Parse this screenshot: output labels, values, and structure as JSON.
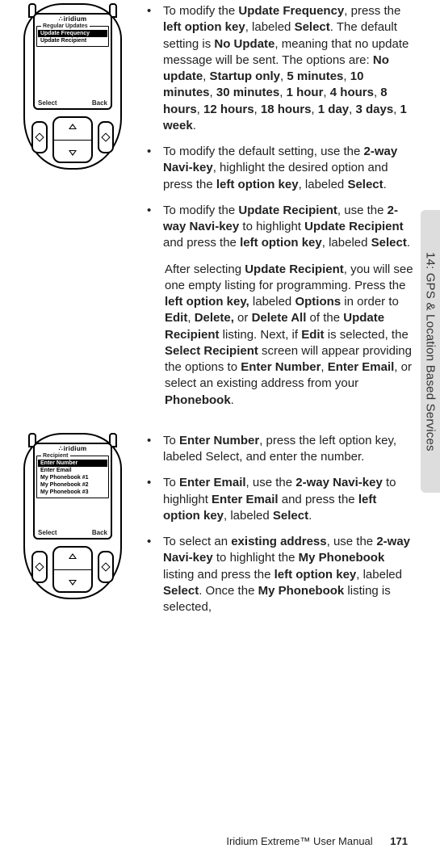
{
  "sideTab": "14: GPS & Location Based Services",
  "footer": {
    "title": "Iridium Extreme™ User Manual",
    "page": "171"
  },
  "device1": {
    "brand": "iridium",
    "menuTitle": "Regular Updates",
    "items": [
      "Update Frequency",
      "Update Recipient"
    ],
    "selectedIndex": 0,
    "softLeft": "Select",
    "softRight": "Back"
  },
  "device2": {
    "brand": "iridium",
    "menuTitle": "Recipient",
    "items": [
      "Enter Number",
      "Enter Email",
      "My Phonebook #1",
      "My Phonebook #2",
      "My Phonebook #3"
    ],
    "selectedIndex": 0,
    "softLeft": "Select",
    "softRight": "Back"
  },
  "text": {
    "b1a": "To modify the ",
    "b1b": "Update Frequency",
    "b1c": ", press the ",
    "b1d": "left option key",
    "b1e": ", labeled ",
    "b1f": "Select",
    "b1g": ". The default setting is ",
    "b1h": "No Update",
    "b1i": ", meaning that no update message will be sent. The options are: ",
    "b1j": "No update",
    "b1k": ", ",
    "b1l": "Startup only",
    "b1m": ", ",
    "b1n": "5 minutes",
    "b1o": ", ",
    "b1p": "10 minutes",
    "b1q": ", ",
    "b1r": "30 minutes",
    "b1s": ", ",
    "b1t": "1 hour",
    "b1u": ", ",
    "b1v": "4 hours",
    "b1w": ", ",
    "b1x": "8 hours",
    "b1y": ", ",
    "b1z": "12 hours",
    "b1aa": ", ",
    "b1ab": "18 hours",
    "b1ac": ", ",
    "b1ad": "1 day",
    "b1ae": ", ",
    "b1af": "3 days",
    "b1ag": ", ",
    "b1ah": "1 week",
    "b1ai": ".",
    "b2a": "To modify the default setting, use the ",
    "b2b": "2-way Navi-key",
    "b2c": ", highlight the desired option and press the ",
    "b2d": "left option key",
    "b2e": ", labeled ",
    "b2f": "Select",
    "b2g": ".",
    "b3a": "To modify the ",
    "b3b": "Update Recipient",
    "b3c": ", use the ",
    "b3d": "2-way Navi-key",
    "b3e": " to highlight ",
    "b3f": "Update Recipient",
    "b3g": " and press the ",
    "b3h": "left option key",
    "b3i": ", labeled ",
    "b3j": "Select",
    "b3k": ".",
    "p1a": "After selecting ",
    "p1b": "Update Recipient",
    "p1c": ", you will see one empty listing for programming. Press the ",
    "p1d": "left option key,",
    "p1e": " labeled ",
    "p1f": "Options",
    "p1g": " in order to ",
    "p1h": "Edit",
    "p1i": ", ",
    "p1j": "Delete,",
    "p1k": " or ",
    "p1l": "Delete All",
    "p1m": " of the ",
    "p1n": "Update Recipient",
    "p1o": " listing. Next, if ",
    "p1p": "Edit",
    "p1q": " is selected, the ",
    "p1r": "Select Recipient",
    "p1s": " screen will appear providing the options to ",
    "p1t": "Enter Number",
    "p1u": ", ",
    "p1v": "Enter Email",
    "p1w": ", or select an existing address from your ",
    "p1x": "Phonebook",
    "p1y": ".",
    "c1a": "To ",
    "c1b": "Enter Number",
    "c1c": ", press the left option key, labeled Select, and enter the number.",
    "c2a": "To ",
    "c2b": "Enter Email",
    "c2c": ", use the ",
    "c2d": "2-way Navi-key",
    "c2e": " to highlight ",
    "c2f": "Enter Email",
    "c2g": " and press the ",
    "c2h": "left option key",
    "c2i": ", labeled ",
    "c2j": "Select",
    "c2k": ".",
    "c3a": "To select an ",
    "c3b": "existing address",
    "c3c": ", use the ",
    "c3d": "2-way Navi-key",
    "c3e": " to highlight the ",
    "c3f": "My Phonebook",
    "c3g": " listing and press the ",
    "c3h": "left option key",
    "c3i": ", labeled ",
    "c3j": "Select",
    "c3k": ". Once the ",
    "c3l": "My Phonebook",
    "c3m": " listing is selected,"
  }
}
